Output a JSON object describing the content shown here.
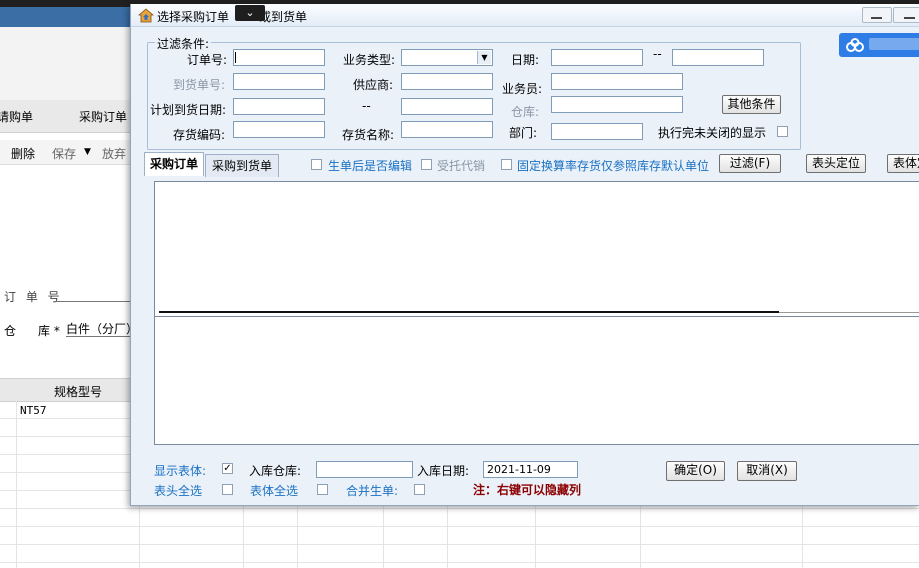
{
  "background": {
    "menu_items": [
      "请购单",
      "采购订单"
    ],
    "tools": [
      "删除",
      "保存",
      "放弃"
    ],
    "form": {
      "order_no_label": "订 单 号",
      "warehouse_label_1": "仓",
      "warehouse_label_2": "库 *",
      "warehouse_value": "白件（分厂）"
    },
    "grid_header": "规格型号",
    "grid_cell": "NT57"
  },
  "dialog": {
    "title_part1": "选择采购订单",
    "title_part2": "或到货单",
    "filter_group_label": "过滤条件:",
    "fields": {
      "order_no": "订单号:",
      "business_type": "业务类型:",
      "date": "日期:",
      "date_separator": "--",
      "arrival_no": "到货单号:",
      "supplier": "供应商:",
      "clerk": "业务员:",
      "planned_arrival_date": "计划到货日期:",
      "planned_separator": "--",
      "warehouse": "仓库:",
      "inventory_code": "存货编码:",
      "inventory_name": "存货名称:",
      "department": "部门:",
      "show_unclosed": "执行完未关闭的显示"
    },
    "buttons": {
      "other_conditions": "其他条件",
      "filter": "过滤(F)",
      "header_locate": "表头定位",
      "body_locate": "表体定位",
      "ok": "确定(O)",
      "cancel": "取消(X)"
    },
    "tabs": [
      "采购订单",
      "采购到货单"
    ],
    "options": {
      "edit_after_generate": "生单后是否编辑",
      "entrusted_agent": "受托代销",
      "fixed_conversion": "固定换算率存货仅参照库存默认单位"
    },
    "footer": {
      "show_body": "显示表体:",
      "inbound_warehouse": "入库仓库:",
      "inbound_date": "入库日期:",
      "inbound_date_value": "2021-11-09",
      "header_select_all": "表头全选",
      "body_select_all": "表体全选",
      "merge_orders": "合并生单:",
      "note": "注：右键可以隐藏列"
    }
  }
}
